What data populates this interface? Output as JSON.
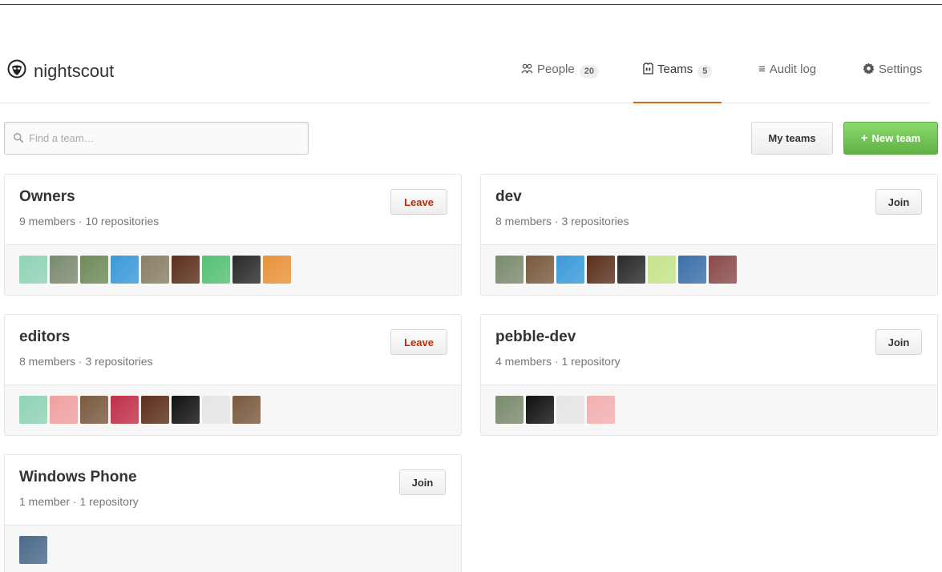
{
  "org": {
    "name": "nightscout"
  },
  "nav": [
    {
      "label": "People",
      "count": "20",
      "icon": "person-icon"
    },
    {
      "label": "Teams",
      "count": "5",
      "icon": "jersey-icon"
    },
    {
      "label": "Audit log",
      "icon": "list-icon"
    },
    {
      "label": "Settings",
      "icon": "gear-icon"
    }
  ],
  "search": {
    "placeholder": "Find a team…",
    "value": ""
  },
  "buttons": {
    "my_teams": "My teams",
    "new_team": "New team"
  },
  "colors": {
    "accent_tab": "#d26911",
    "new_team_green": "#60b044",
    "leave_red": "#bd2c00"
  },
  "teams": [
    {
      "name": "Owners",
      "meta": "9 members · 10 repositories",
      "action": "Leave",
      "avatars": [
        "#8fd3b6",
        "#7a8b6f",
        "#6f8a5a",
        "#3a9ad9",
        "#8a7f66",
        "#5c2f1c",
        "#55c275",
        "#2a2a2a",
        "#e8933a"
      ]
    },
    {
      "name": "dev",
      "meta": "8 members · 3 repositories",
      "action": "Join",
      "avatars": [
        "#7a8b6f",
        "#7a5a3f",
        "#3a9ad9",
        "#5c2f1c",
        "#2a2a2a",
        "#c6e48b",
        "#3b6fa8",
        "#8a4b4b"
      ]
    },
    {
      "name": "editors",
      "meta": "8 members · 3 repositories",
      "action": "Leave",
      "avatars": [
        "#8fd3b6",
        "#f0a0a0",
        "#7a5a3f",
        "#c0304a",
        "#5c2f1c",
        "#111111",
        "#e6e6e6",
        "#7a5a3f"
      ]
    },
    {
      "name": "pebble-dev",
      "meta": "4 members · 1 repository",
      "action": "Join",
      "avatars": [
        "#7a8b6f",
        "#111111",
        "#e6e6e6",
        "#f3b0b0"
      ]
    },
    {
      "name": "Windows Phone",
      "meta": "1 member · 1 repository",
      "action": "Join",
      "avatars": [
        "#4a6a8a"
      ]
    }
  ]
}
